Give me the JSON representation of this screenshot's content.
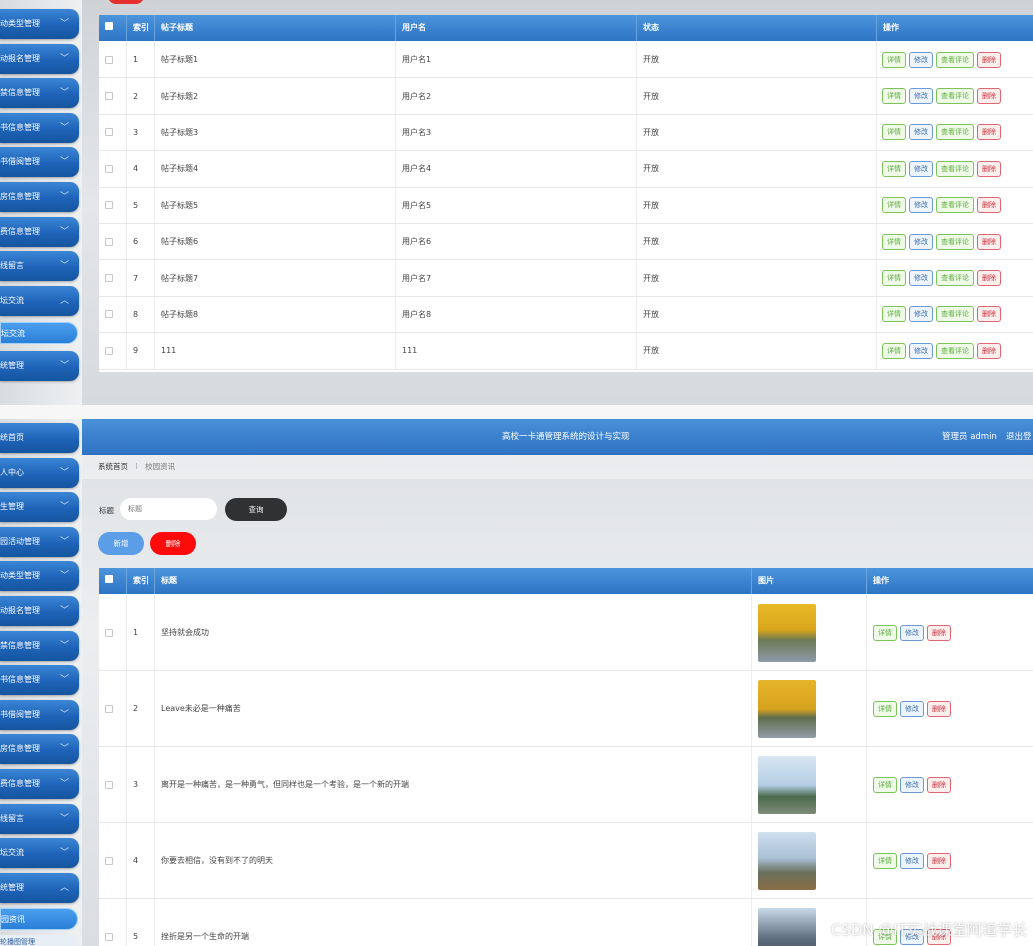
{
  "top_panel": {
    "sidebar": [
      {
        "label": "活动类型管理",
        "chevron": "﹀"
      },
      {
        "label": "活动报名管理",
        "chevron": "﹀"
      },
      {
        "label": "门禁信息管理",
        "chevron": "﹀"
      },
      {
        "label": "图书信息管理",
        "chevron": "﹀"
      },
      {
        "label": "图书借阅管理",
        "chevron": "﹀"
      },
      {
        "label": "机房信息管理",
        "chevron": "﹀"
      },
      {
        "label": "消费信息管理",
        "chevron": "﹀"
      },
      {
        "label": "在线留言",
        "chevron": "﹀"
      },
      {
        "label": "论坛交流",
        "chevron": "︿"
      },
      {
        "label": "系统管理",
        "chevron": "﹀"
      }
    ],
    "active_sub": "坛交流",
    "columns": [
      "索引",
      "帖子标题",
      "用户名",
      "状态",
      "操作"
    ],
    "rows": [
      {
        "index": "1",
        "title": "帖子标题1",
        "user": "用户名1",
        "status": "开放"
      },
      {
        "index": "2",
        "title": "帖子标题2",
        "user": "用户名2",
        "status": "开放"
      },
      {
        "index": "3",
        "title": "帖子标题3",
        "user": "用户名3",
        "status": "开放"
      },
      {
        "index": "4",
        "title": "帖子标题4",
        "user": "用户名4",
        "status": "开放"
      },
      {
        "index": "5",
        "title": "帖子标题5",
        "user": "用户名5",
        "status": "开放"
      },
      {
        "index": "6",
        "title": "帖子标题6",
        "user": "用户名6",
        "status": "开放"
      },
      {
        "index": "7",
        "title": "帖子标题7",
        "user": "用户名7",
        "status": "开放"
      },
      {
        "index": "8",
        "title": "帖子标题8",
        "user": "用户名8",
        "status": "开放"
      },
      {
        "index": "9",
        "title": "111",
        "user": "111",
        "status": "开放"
      }
    ],
    "actions": {
      "detail": "详情",
      "edit": "修改",
      "comments": "查看评论",
      "delete": "删除"
    }
  },
  "bottom_panel": {
    "sidebar": [
      {
        "label": "系统首页",
        "chevron": ""
      },
      {
        "label": "个人中心",
        "chevron": "﹀"
      },
      {
        "label": "学生管理",
        "chevron": "﹀"
      },
      {
        "label": "校园活动管理",
        "chevron": "﹀"
      },
      {
        "label": "活动类型管理",
        "chevron": "﹀"
      },
      {
        "label": "活动报名管理",
        "chevron": "﹀"
      },
      {
        "label": "门禁信息管理",
        "chevron": "﹀"
      },
      {
        "label": "图书信息管理",
        "chevron": "﹀"
      },
      {
        "label": "图书借阅管理",
        "chevron": "﹀"
      },
      {
        "label": "机房信息管理",
        "chevron": "﹀"
      },
      {
        "label": "消费信息管理",
        "chevron": "﹀"
      },
      {
        "label": "在线留言",
        "chevron": "﹀"
      },
      {
        "label": "论坛交流",
        "chevron": "﹀"
      },
      {
        "label": "系统管理",
        "chevron": "︿"
      }
    ],
    "active_sub": "园资讯",
    "next_sub": "轮播图管理",
    "header": {
      "title": "高校一卡通管理系统的设计与实现",
      "user": "管理员 admin",
      "logout": "退出登"
    },
    "breadcrumb": {
      "home": "系统首页",
      "sep": "⁝",
      "current": "校园资讯"
    },
    "search": {
      "label": "标题",
      "placeholder": "标题",
      "button": "查询"
    },
    "add_button": "新增",
    "delete_button": "删除",
    "columns": [
      "索引",
      "标题",
      "图片",
      "操作"
    ],
    "rows": [
      {
        "index": "1",
        "title": "坚持就会成功"
      },
      {
        "index": "2",
        "title": "Leave未必是一种痛苦"
      },
      {
        "index": "3",
        "title": "离开是一种痛苦，是一种勇气，但同样也是一个考验，是一个新的开端"
      },
      {
        "index": "4",
        "title": "你要去相信，没有到不了的明天"
      },
      {
        "index": "5",
        "title": "挫折是另一个生命的开端"
      }
    ],
    "actions": {
      "detail": "详情",
      "edit": "修改",
      "delete": "删除"
    }
  },
  "watermark": "CSDN @IT实战课堂阿瑄学长"
}
